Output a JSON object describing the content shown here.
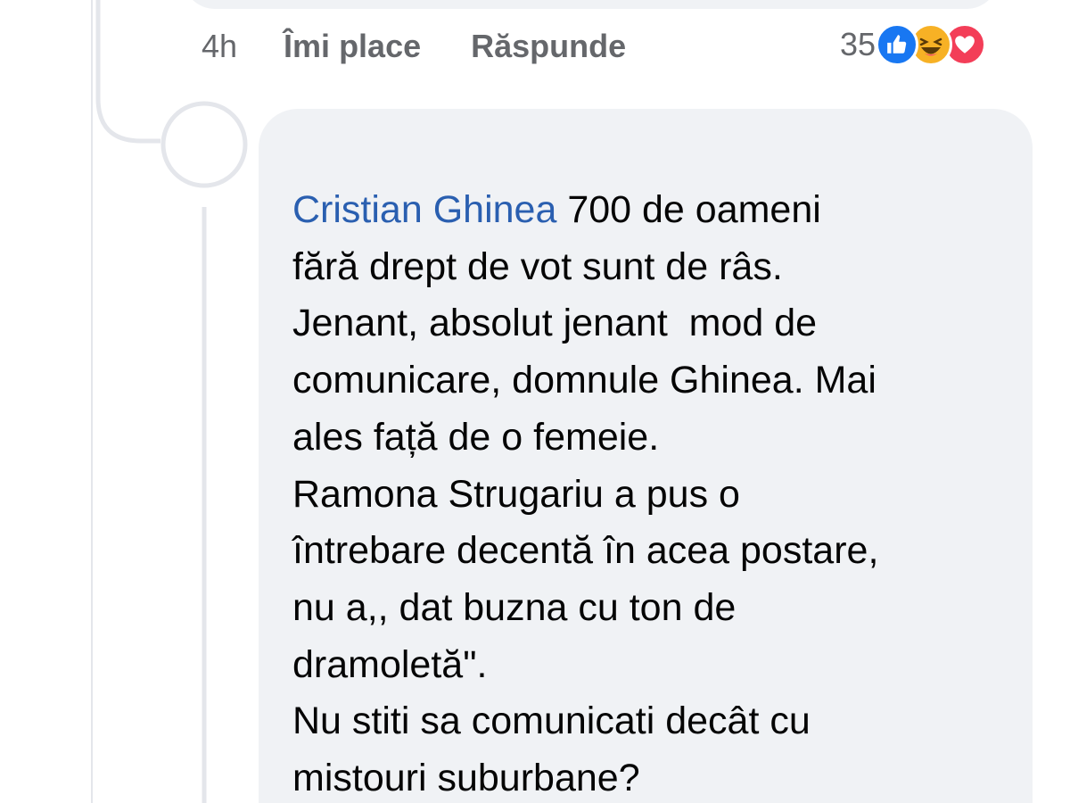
{
  "previous_comment": {
    "time": "4h",
    "like_label": "Îmi place",
    "reply_label": "Răspunde",
    "reaction_count": "35",
    "reactions": [
      "like-icon",
      "haha-icon",
      "love-icon"
    ]
  },
  "reply": {
    "mention": "Cristian Ghinea",
    "first_line_rest": " 700 de oameni",
    "lines": [
      "fără drept de vot sunt de râs.",
      "Jenant, absolut jenant  mod de",
      "comunicare, domnule Ghinea. Mai",
      "ales față de o femeie.",
      "Ramona Strugariu a pus o",
      "întrebare decentă în acea postare,",
      "nu a,, dat buzna cu ton de",
      "dramoletă\".",
      "Nu stiti sa comunicati decât cu",
      "mistouri suburbane?"
    ]
  },
  "colors": {
    "bubble": "#f0f2f5",
    "mention": "#2a5fb0",
    "secondary_text": "#65676b",
    "like": "#1877f2",
    "haha": "#f7b125",
    "love": "#f33e58"
  }
}
